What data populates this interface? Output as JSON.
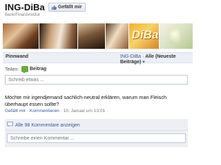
{
  "header": {
    "title": "ING-DiBa",
    "subtitle": "Bank/Finanzinstitut",
    "like_label": "Gefällt mir"
  },
  "banner": {
    "logo_text": "DiBa"
  },
  "tabs": {
    "wall_label": "Pinnwand",
    "filter_prefix": "ING-DiBa",
    "filter_sep": " · ",
    "filter_selected": "Alle (Neueste Beiträge)",
    "filter_arrow": "▾"
  },
  "share": {
    "label": "Teilen:",
    "post_label": "Beitrag",
    "placeholder": "Schreib etwas ..."
  },
  "post": {
    "text": "Möchte mir irgendjemand sachlich-neutral erklären, warum man Fleisch überhaupt essen sollte?",
    "like_link": "Gefällt mir",
    "comment_link": "Kommentieren",
    "sep": " · ",
    "timestamp": "10. Januar um 13:01",
    "trailing_sep": " · "
  },
  "comments": {
    "show_all_label": "Alle 98 Kommentare anzeigen",
    "placeholder": "Schreibe einen Kommentar ..."
  },
  "colors": {
    "link": "#3b5998",
    "tabbar_bg": "#eceff5",
    "comments_bg": "#edeff4",
    "post_icon": "#6cab3c"
  }
}
